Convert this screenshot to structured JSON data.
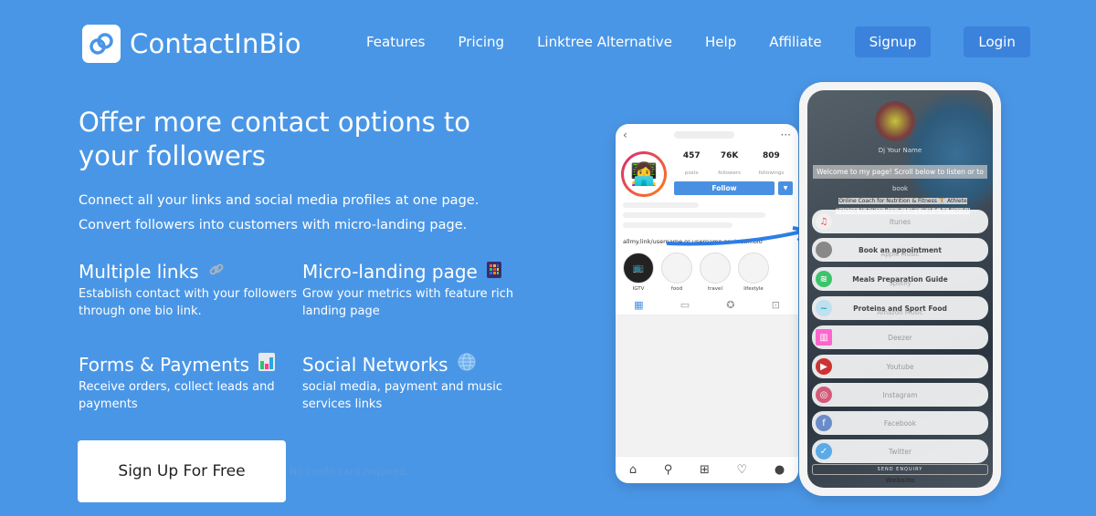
{
  "header": {
    "brand": "ContactInBio",
    "nav": [
      "Features",
      "Pricing",
      "Linktree Alternative",
      "Help",
      "Affiliate"
    ],
    "signup": "Signup",
    "login": "Login"
  },
  "hero": {
    "title": "Offer more contact options to your followers",
    "sub1": "Connect all your links and social media profiles at one page.",
    "sub2": "Convert followers into customers with micro-landing page."
  },
  "features": [
    {
      "title": "Multiple links",
      "icon": "link-icon",
      "desc": "Establish contact with your followers through one bio link."
    },
    {
      "title": "Micro-landing page",
      "icon": "grid-icon",
      "desc": "Grow your metrics with feature rich landing page"
    },
    {
      "title": "Forms & Payments",
      "icon": "bar-chart-icon",
      "desc": "Receive orders, collect leads and payments"
    },
    {
      "title": "Social Networks",
      "icon": "globe-icon",
      "desc": "social media, payment and music services links"
    }
  ],
  "cta": {
    "label": "Sign Up For Free",
    "note": "No credit card required."
  },
  "instagram": {
    "stats": [
      {
        "value": "457",
        "label": "posts"
      },
      {
        "value": "76K",
        "label": "followers"
      },
      {
        "value": "809",
        "label": "followings"
      }
    ],
    "follow": "Follow",
    "bio_link": "allmy.link/username or username.contactin.bio",
    "highlights": [
      "IGTV",
      "food",
      "travel",
      "lifestyle"
    ]
  },
  "bio_page": {
    "name": "Dj Your Name",
    "welcome": "Welcome to my page! Scroll below to listen or to",
    "book": "book",
    "bio1": "Online Coach for Nutrition & Fitness 🏋 Athlete",
    "bio2": "Training Nutrition Beauty Let's chat & be friends!",
    "itunes": "Itunes",
    "buttons": [
      {
        "label": "Book an appointment",
        "ghost": "Apple Music"
      },
      {
        "label": "Meals Preparation Guide",
        "ghost": "Spotify"
      },
      {
        "label": "Proteins and Sport Food",
        "ghost": "Amazon Music"
      }
    ],
    "links": [
      "Deezer",
      "Youtube",
      "Instagram",
      "Facebook",
      "Twitter"
    ],
    "send": "SEND ENQUIRY",
    "website": "Website"
  }
}
